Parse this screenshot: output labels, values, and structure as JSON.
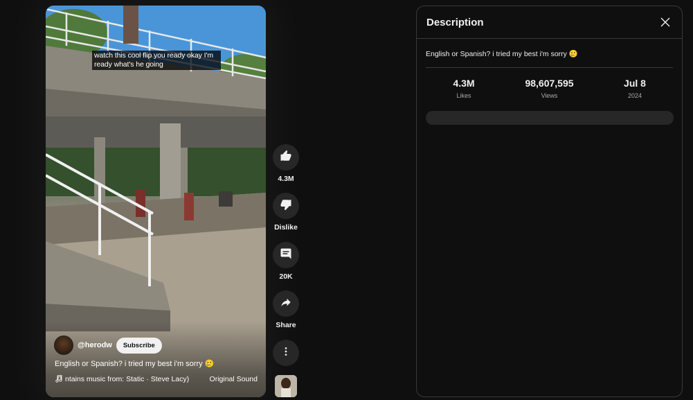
{
  "video": {
    "caption": "watch this cool flip you ready okay I'm ready what's he going",
    "channel_handle": "@herodw",
    "subscribe_label": "Subscribe",
    "title": "English or Spanish? i tried my best i'm sorry 🥲",
    "music_track": "ntains music from: Static · Steve Lacy)",
    "sound_label": "Original Sound"
  },
  "actions": {
    "like_count": "4.3M",
    "dislike_label": "Dislike",
    "comment_count": "20K",
    "share_label": "Share",
    "icons": [
      "thumbs-up-icon",
      "thumbs-down-icon",
      "comment-icon",
      "share-icon",
      "more-vert-icon"
    ]
  },
  "description_panel": {
    "title": "Description",
    "text": "English or Spanish? i tried my best i'm sorry 🥲",
    "stats": [
      {
        "value": "4.3M",
        "label": "Likes"
      },
      {
        "value": "98,607,595",
        "label": "Views"
      },
      {
        "value": "Jul 8",
        "label": "2024"
      }
    ]
  },
  "colors": {
    "background": "#0f0f0f",
    "button": "#272727",
    "text": "#f1f1f1",
    "muted": "#aaaaaa",
    "border": "#3a3a3a"
  }
}
